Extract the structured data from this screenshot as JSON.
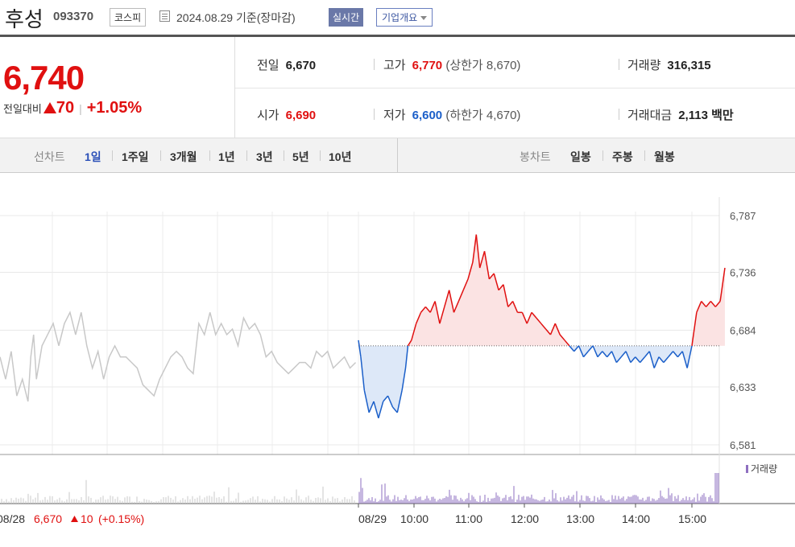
{
  "header": {
    "name": "후성",
    "code": "093370",
    "market": "코스피",
    "date": "2024.08.29 기준(장마감)",
    "realtime_label": "실시간",
    "company_label": "기업개요"
  },
  "price": {
    "current": "6,740",
    "change_label": "전일대비",
    "change": "70",
    "change_pct": "+1.05%"
  },
  "info": {
    "prev_label": "전일",
    "prev": "6,670",
    "high_label": "고가",
    "high": "6,770",
    "upper_limit": "(상한가 8,670)",
    "volume_label": "거래량",
    "volume": "316,315",
    "open_label": "시가",
    "open": "6,690",
    "low_label": "저가",
    "low": "6,600",
    "lower_limit": "(하한가 4,670)",
    "amount_label": "거래대금",
    "amount": "2,113 백만"
  },
  "tabs": {
    "line_label": "선차트",
    "periods": [
      "1일",
      "1주일",
      "3개월",
      "1년",
      "3년",
      "5년",
      "10년"
    ],
    "selected": "1일",
    "candle_label": "봉차트",
    "candles": [
      "일봉",
      "주봉",
      "월봉"
    ]
  },
  "colors": {
    "up": "#e01010",
    "down": "#1b5fc9",
    "prev_day": "#c8c8c8",
    "volume": "#8e6fc0"
  },
  "chart_data": {
    "type": "line",
    "y_ticks": [
      6787,
      6736,
      6684,
      6633,
      6581
    ],
    "ylim": [
      6581,
      6787
    ],
    "baseline": 6670,
    "x_ticks": [
      "08/29",
      "10:00",
      "11:00",
      "12:00",
      "13:00",
      "14:00",
      "15:00"
    ],
    "prev_footer": {
      "date": "08/28",
      "close": "6,670",
      "change": "10",
      "change_pct": "(+0.15%)"
    },
    "volume_label": "거래량",
    "grid": true,
    "series": [
      {
        "values": [
          [
            0.0,
            6660
          ],
          [
            0.02,
            6640
          ],
          [
            0.04,
            6665
          ],
          [
            0.06,
            6625
          ],
          [
            0.08,
            6640
          ],
          [
            0.1,
            6620
          ],
          [
            0.11,
            6660
          ],
          [
            0.12,
            6680
          ],
          [
            0.13,
            6640
          ],
          [
            0.15,
            6670
          ],
          [
            0.17,
            6680
          ],
          [
            0.19,
            6690
          ],
          [
            0.21,
            6670
          ],
          [
            0.23,
            6690
          ],
          [
            0.25,
            6700
          ],
          [
            0.27,
            6680
          ],
          [
            0.29,
            6700
          ],
          [
            0.31,
            6670
          ],
          [
            0.33,
            6650
          ],
          [
            0.35,
            6665
          ],
          [
            0.37,
            6640
          ],
          [
            0.39,
            6660
          ],
          [
            0.41,
            6670
          ],
          [
            0.43,
            6660
          ],
          [
            0.45,
            6660
          ],
          [
            0.47,
            6655
          ],
          [
            0.49,
            6650
          ],
          [
            0.51,
            6635
          ],
          [
            0.53,
            6630
          ],
          [
            0.55,
            6625
          ],
          [
            0.57,
            6640
          ],
          [
            0.59,
            6650
          ],
          [
            0.61,
            6660
          ],
          [
            0.63,
            6665
          ],
          [
            0.65,
            6660
          ],
          [
            0.67,
            6650
          ],
          [
            0.69,
            6645
          ],
          [
            0.71,
            6690
          ],
          [
            0.73,
            6680
          ],
          [
            0.75,
            6700
          ],
          [
            0.77,
            6680
          ],
          [
            0.79,
            6690
          ],
          [
            0.81,
            6680
          ],
          [
            0.83,
            6685
          ],
          [
            0.85,
            6670
          ],
          [
            0.87,
            6695
          ],
          [
            0.89,
            6685
          ],
          [
            0.91,
            6690
          ],
          [
            0.93,
            6680
          ],
          [
            0.95,
            6660
          ],
          [
            0.97,
            6665
          ],
          [
            0.99,
            6655
          ],
          [
            1.01,
            6650
          ],
          [
            1.03,
            6645
          ],
          [
            1.05,
            6650
          ],
          [
            1.07,
            6655
          ],
          [
            1.09,
            6655
          ],
          [
            1.11,
            6650
          ],
          [
            1.13,
            6665
          ],
          [
            1.15,
            6660
          ],
          [
            1.17,
            6665
          ],
          [
            1.19,
            6650
          ],
          [
            1.21,
            6655
          ],
          [
            1.23,
            6660
          ],
          [
            1.25,
            6650
          ],
          [
            1.27,
            6655
          ]
        ]
      },
      {
        "values": [
          [
            1.285,
            6675
          ],
          [
            1.295,
            6660
          ],
          [
            1.31,
            6630
          ],
          [
            1.33,
            6610
          ],
          [
            1.35,
            6620
          ],
          [
            1.37,
            6605
          ],
          [
            1.39,
            6620
          ],
          [
            1.41,
            6625
          ],
          [
            1.43,
            6615
          ],
          [
            1.45,
            6610
          ],
          [
            1.47,
            6630
          ],
          [
            1.485,
            6650
          ],
          [
            1.495,
            6670
          ],
          [
            1.51,
            6675
          ],
          [
            1.53,
            6690
          ],
          [
            1.55,
            6700
          ],
          [
            1.57,
            6705
          ],
          [
            1.59,
            6700
          ],
          [
            1.61,
            6710
          ],
          [
            1.63,
            6690
          ],
          [
            1.65,
            6705
          ],
          [
            1.67,
            6720
          ],
          [
            1.69,
            6700
          ],
          [
            1.71,
            6710
          ],
          [
            1.73,
            6720
          ],
          [
            1.75,
            6730
          ],
          [
            1.77,
            6745
          ],
          [
            1.785,
            6770
          ],
          [
            1.8,
            6740
          ],
          [
            1.82,
            6755
          ],
          [
            1.84,
            6730
          ],
          [
            1.86,
            6735
          ],
          [
            1.88,
            6720
          ],
          [
            1.9,
            6725
          ],
          [
            1.92,
            6705
          ],
          [
            1.94,
            6710
          ],
          [
            1.96,
            6700
          ],
          [
            1.98,
            6700
          ],
          [
            2.0,
            6690
          ],
          [
            2.02,
            6700
          ],
          [
            2.04,
            6695
          ],
          [
            2.06,
            6690
          ],
          [
            2.08,
            6685
          ],
          [
            2.1,
            6680
          ],
          [
            2.12,
            6690
          ],
          [
            2.14,
            6680
          ],
          [
            2.16,
            6675
          ],
          [
            2.18,
            6670
          ],
          [
            2.2,
            6665
          ],
          [
            2.22,
            6670
          ],
          [
            2.24,
            6660
          ],
          [
            2.26,
            6665
          ],
          [
            2.28,
            6670
          ],
          [
            2.3,
            6660
          ],
          [
            2.32,
            6665
          ],
          [
            2.34,
            6660
          ],
          [
            2.36,
            6665
          ],
          [
            2.38,
            6655
          ],
          [
            2.4,
            6660
          ],
          [
            2.42,
            6665
          ],
          [
            2.44,
            6655
          ],
          [
            2.46,
            6660
          ],
          [
            2.48,
            6655
          ],
          [
            2.5,
            6660
          ],
          [
            2.52,
            6665
          ],
          [
            2.54,
            6650
          ],
          [
            2.56,
            6660
          ],
          [
            2.58,
            6655
          ],
          [
            2.6,
            6660
          ],
          [
            2.62,
            6665
          ],
          [
            2.64,
            6660
          ],
          [
            2.66,
            6665
          ],
          [
            2.68,
            6650
          ],
          [
            2.7,
            6670
          ],
          [
            2.72,
            6700
          ],
          [
            2.74,
            6710
          ],
          [
            2.76,
            6705
          ],
          [
            2.78,
            6710
          ],
          [
            2.8,
            6705
          ],
          [
            2.82,
            6710
          ],
          [
            2.84,
            6740
          ]
        ]
      }
    ]
  }
}
